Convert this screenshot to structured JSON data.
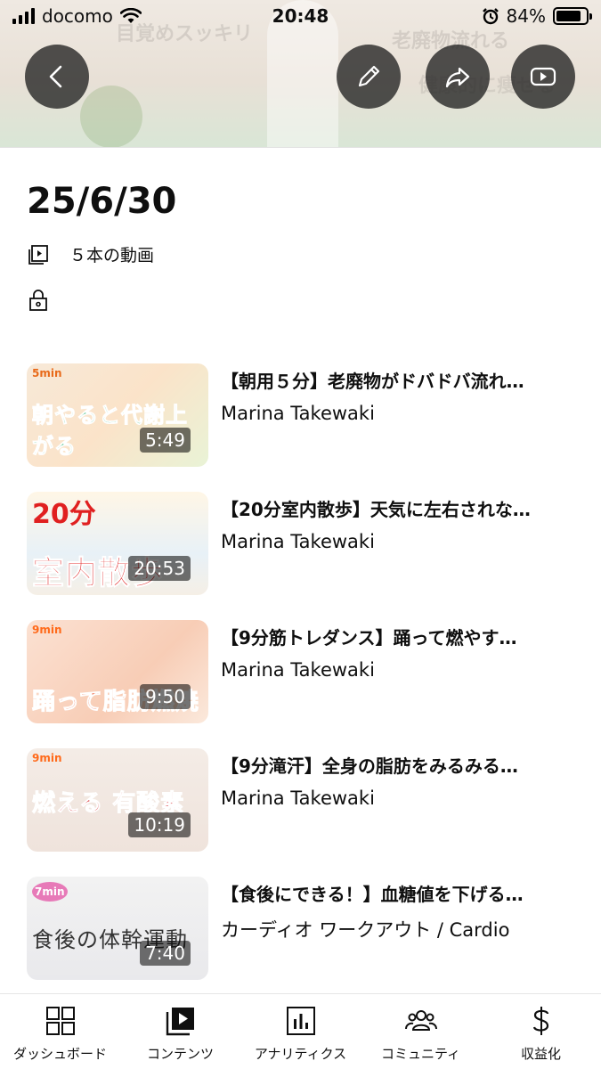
{
  "status_bar": {
    "carrier": "docomo",
    "time": "20:48",
    "battery": "84%",
    "battery_level": 0.84
  },
  "header": {
    "banner_texts": [
      "目覚めスッキリ",
      "老廃物流れる",
      "健康的に痩せる"
    ]
  },
  "playlist": {
    "title": "25/6/30",
    "video_count": "５本の動画"
  },
  "videos": [
    {
      "title": "【朝用５分】老廃物がドバドバ流れ…",
      "channel": "Marina Takewaki",
      "duration": "5:49",
      "thumb_text": "朝やると代謝上がる",
      "thumb_badge": "5min"
    },
    {
      "title": "【20分室内散歩】天気に左右されな…",
      "channel": "Marina Takewaki",
      "duration": "20:53",
      "thumb_text": "室内散歩",
      "thumb_badge": "20分"
    },
    {
      "title": "【9分筋トレダンス】踊って燃やす…",
      "channel": "Marina Takewaki",
      "duration": "9:50",
      "thumb_text": "踊って脂肪燃焼",
      "thumb_badge": "9min"
    },
    {
      "title": "【9分滝汗】全身の脂肪をみるみる…",
      "channel": "Marina Takewaki",
      "duration": "10:19",
      "thumb_text": "燃える 有酸素",
      "thumb_badge": "9min"
    },
    {
      "title": "【食後にできる！】血糖値を下げる…",
      "channel": "カーディオ ワークアウト / Cardio",
      "duration": "7:40",
      "thumb_text": "食後の体幹運動",
      "thumb_badge": "7min"
    }
  ],
  "bottom_nav": [
    {
      "label": "ダッシュボード",
      "icon": "dashboard-icon"
    },
    {
      "label": "コンテンツ",
      "icon": "content-icon"
    },
    {
      "label": "アナリティクス",
      "icon": "analytics-icon"
    },
    {
      "label": "コミュニティ",
      "icon": "community-icon"
    },
    {
      "label": "収益化",
      "icon": "dollar-icon"
    }
  ]
}
